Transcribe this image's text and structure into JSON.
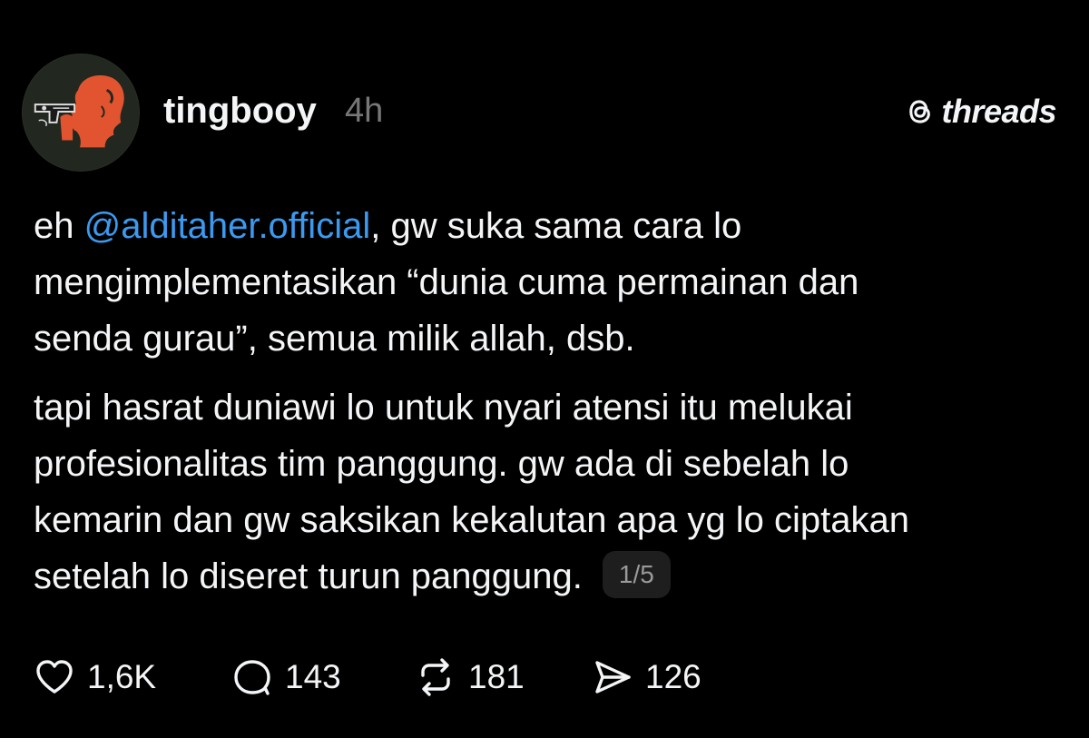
{
  "post": {
    "author": {
      "username": "tingbooy",
      "avatar_icon": "avatar-icon",
      "avatar_colors": {
        "background": "#22281f",
        "figure": "#e2532f"
      }
    },
    "timestamp": "4h",
    "brand": {
      "name": "threads",
      "icon": "threads-logo-icon"
    },
    "body": {
      "paragraph1": {
        "line1_prefix": "eh ",
        "mention": "@alditaher.official",
        "line1_suffix": ", gw suka sama cara lo",
        "line2": "mengimplementasikan “dunia cuma permainan dan",
        "line3": "senda gurau”, semua milik allah, dsb."
      },
      "paragraph2": {
        "line1": "tapi hasrat duniawi lo untuk nyari atensi itu melukai",
        "line2": "profesionalitas tim panggung. gw ada di sebelah lo",
        "line3": "kemarin dan gw saksikan kekalutan apa yg lo ciptakan",
        "line4": "setelah lo diseret turun panggung."
      },
      "thread_position": "1/5"
    },
    "actions": {
      "like": {
        "icon": "heart-icon",
        "count": "1,6K"
      },
      "reply": {
        "icon": "comment-icon",
        "count": "143"
      },
      "repost": {
        "icon": "repost-icon",
        "count": "181"
      },
      "share": {
        "icon": "send-icon",
        "count": "126"
      }
    },
    "colors": {
      "background": "#000000",
      "text": "#f3f5f7",
      "muted": "#777777",
      "mention": "#3b9af0"
    }
  }
}
